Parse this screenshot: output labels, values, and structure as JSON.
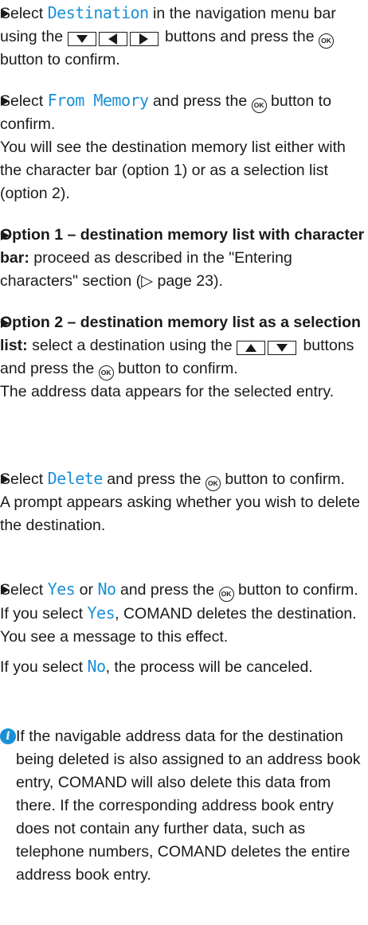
{
  "steps": [
    {
      "parts": [
        "Select",
        "Destination",
        "in the navigation menu bar using the",
        "buttons and press the",
        "button to confirm."
      ]
    },
    {
      "parts": [
        "Select",
        "From Memory",
        "and press the",
        "button to confirm."
      ],
      "result": "You will see the destination memory list either with the character bar (option 1) or as a selection list (option 2)."
    },
    {
      "bold": "Option 1 – destination memory list with character bar:",
      "text": "proceed as described in the \"Entering characters\" section (▷ page 23)."
    },
    {
      "bold": "Option 2 – destination memory list as a selection list:",
      "parts": [
        "select a destination using the",
        "buttons and press the",
        "button to confirm."
      ],
      "result": "The address data appears for the selected entry."
    },
    {
      "parts": [
        "Select",
        "Delete",
        "and press the",
        "button to confirm."
      ],
      "result": "A prompt appears asking whether you wish to delete the destination."
    },
    {
      "parts": [
        "Select",
        "Yes",
        "or",
        "No",
        "and press the",
        "button to confirm."
      ],
      "result1_parts": [
        "If you select",
        "Yes",
        ", COMAND deletes the destination. You see a message to this effect."
      ],
      "result2_parts": [
        "If you select",
        "No",
        ", the process will be canceled."
      ]
    }
  ],
  "ok_label": "OK",
  "info_icon": "info-icon",
  "info_glyph": "i",
  "info_text": "If the navigable address data for the destination being deleted is also assigned to an address book entry, COMAND will also delete this data from there. If the corresponding address book entry does not contain any further data, such as telephone numbers, COMAND deletes the entire address book entry.",
  "colors": {
    "menu_text": "#1a8fd6",
    "text": "#1a1a1a"
  }
}
